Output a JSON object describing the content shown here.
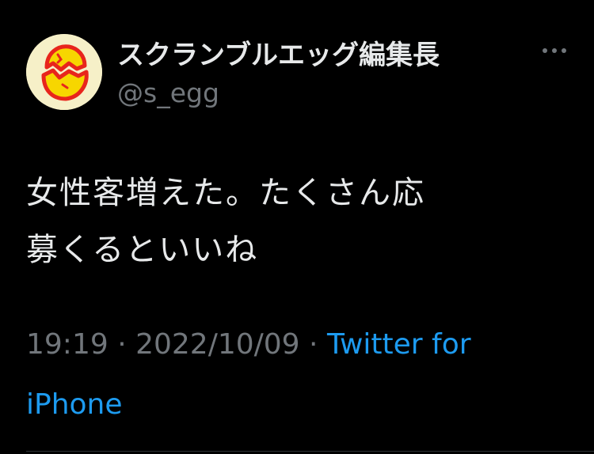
{
  "tweet": {
    "display_name": "スクランブルエッグ編集長",
    "handle": "@s_egg",
    "text_line1": "女性客増えた。たくさん応",
    "text_line2": "募くるといいね",
    "time": "19:19",
    "separator1": " · ",
    "date": "2022/10/09",
    "separator2": " · ",
    "source": "Twitter for iPhone",
    "avatar_icon": "cracked-egg-icon",
    "more_icon": "more-horizontal-icon"
  },
  "colors": {
    "background": "#000000",
    "text_primary": "#e7e9ea",
    "text_secondary": "#71767b",
    "link": "#1d9bf0",
    "avatar_bg": "#f6f0c8",
    "egg_yellow": "#f7d600",
    "egg_red": "#e8251c"
  }
}
